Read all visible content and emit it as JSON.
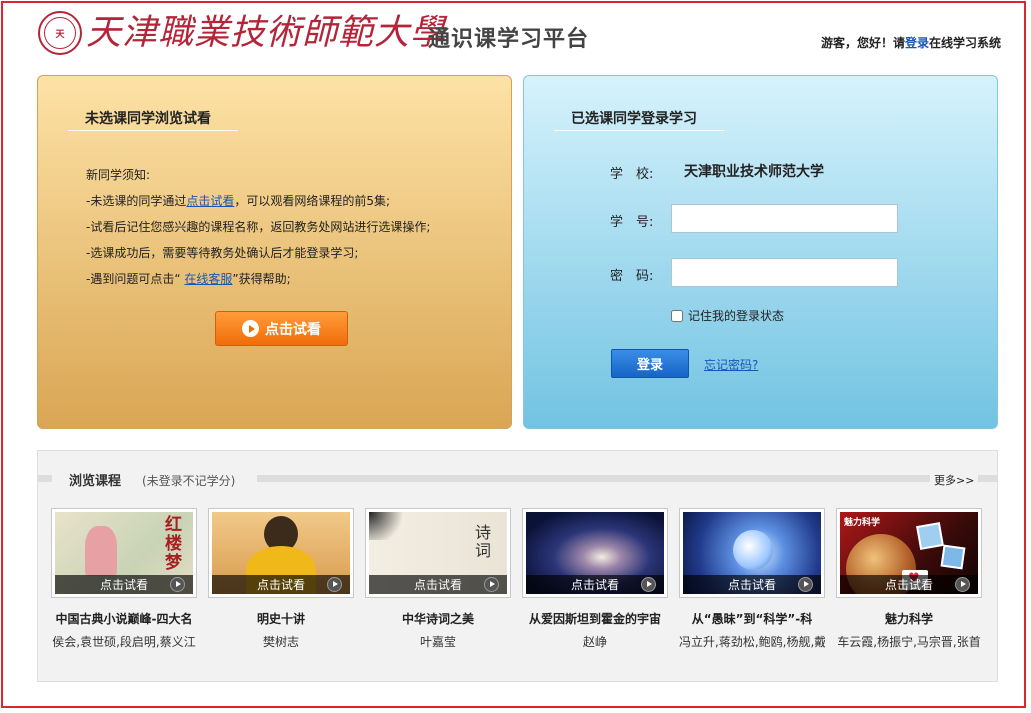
{
  "header": {
    "logo_text": "天津職業技術師範大學",
    "platform_title": "通识课学习平台",
    "user_greeting": "游客，您好！请",
    "login_link": "登录",
    "user_suffix": "在线学习系统"
  },
  "left_panel": {
    "title": "未选课同学浏览试看",
    "notice_heading": "新同学须知:",
    "line1_prefix": "-未选课的同学通过",
    "line1_link": "点击试看",
    "line1_suffix": "，可以观看网络课程的前5集;",
    "line2": "-试看后记住您感兴趣的课程名称，返回教务处网站进行选课操作;",
    "line3": "-选课成功后，需要等待教务处确认后才能登录学习;",
    "line4_prefix": "-遇到问题可点击“",
    "line4_link": "在线客服",
    "line4_suffix": "”获得帮助;",
    "trial_button": "点击试看"
  },
  "right_panel": {
    "title": "已选课同学登录学习",
    "school_label": "学　校:",
    "school_value": "天津职业技术师范大学",
    "student_id_label": "学　号:",
    "student_id_value": "",
    "password_label": "密　码:",
    "password_value": "",
    "remember_label": "记住我的登录状态",
    "login_button": "登录",
    "forgot_link": "忘记密码?"
  },
  "browse": {
    "title": "浏览课程",
    "subtitle": "(未登录不记学分)",
    "more": "更多>>",
    "courses": [
      {
        "title": "中国古典小说巅峰-四大名",
        "teacher": "侯会,袁世硕,段启明,蔡义江",
        "overlay": "点击试看",
        "art_text": "红楼梦"
      },
      {
        "title": "明史十讲",
        "teacher": "樊树志",
        "overlay": "点击试看"
      },
      {
        "title": "中华诗词之美",
        "teacher": "叶嘉莹",
        "overlay": "点击试看",
        "art_text": "诗词"
      },
      {
        "title": "从爱因斯坦到霍金的宇宙",
        "teacher": "赵峥",
        "overlay": "点击试看"
      },
      {
        "title": "从“愚昧”到“科学”-科",
        "teacher": "冯立升,蒋劲松,鲍鸥,杨舰,戴",
        "overlay": "点击试看"
      },
      {
        "title": "魅力科学",
        "teacher": "车云霞,杨振宁,马宗晋,张首",
        "overlay": "点击试看",
        "art_text": "魅力科学"
      }
    ]
  },
  "colors": {
    "brand_red": "#b3263a",
    "frame_red": "#d8282f",
    "link_blue": "#1a55b8",
    "trial_orange": "#ef6d09",
    "login_blue": "#1565c6"
  }
}
